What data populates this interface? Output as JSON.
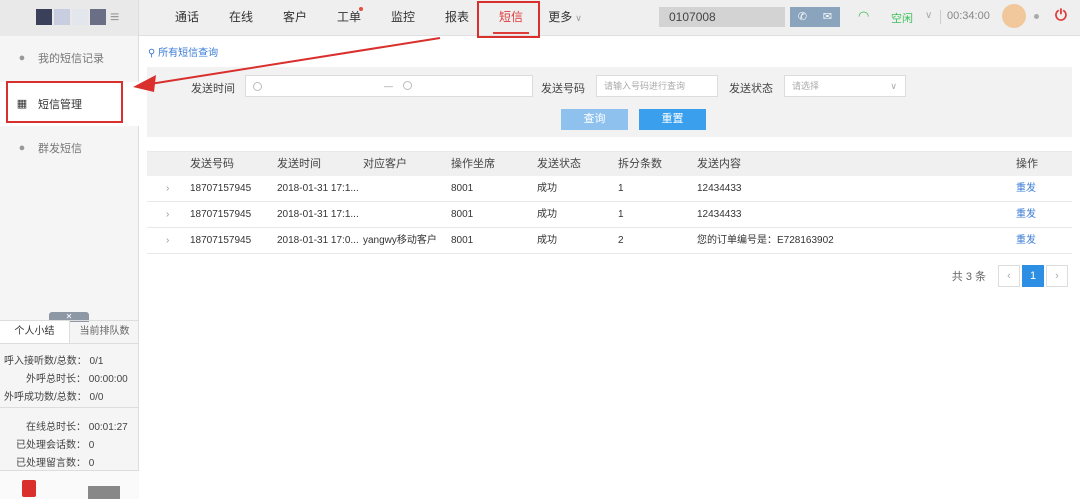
{
  "nav": {
    "items": [
      {
        "label": "通话",
        "dot": false
      },
      {
        "label": "在线",
        "dot": false
      },
      {
        "label": "客户",
        "dot": false
      },
      {
        "label": "工单",
        "dot": true
      },
      {
        "label": "监控",
        "dot": false
      },
      {
        "label": "报表",
        "dot": false
      },
      {
        "label": "短信",
        "dot": false,
        "active": true
      },
      {
        "label": "更多",
        "dot": false
      }
    ]
  },
  "header": {
    "phone_number": "0107008",
    "status": "空闲",
    "timer": "00:34:00"
  },
  "sidebar": {
    "items": [
      {
        "label": "我的短信记录",
        "icon": "chat-icon"
      },
      {
        "label": "短信管理",
        "icon": "grid-icon",
        "active": true
      },
      {
        "label": "群发短信",
        "icon": "group-chat-icon"
      }
    ],
    "stats_tabs": [
      "个人小结",
      "当前排队数"
    ],
    "stats": [
      "呼入接听数/总数： 0/1",
      "外呼总时长： 00:00:00",
      "外呼成功数/总数： 0/0",
      "在线总时长： 00:01:27",
      "已处理会话数： 0",
      "已处理留言数： 0"
    ]
  },
  "main": {
    "breadcrumb": "所有短信查询",
    "filters": {
      "send_time_label": "发送时间",
      "range_separator": "—",
      "send_number_label": "发送号码",
      "send_number_placeholder": "请输入号码进行查询",
      "send_status_label": "发送状态",
      "send_status_placeholder": "请选择"
    },
    "buttons": {
      "query": "查询",
      "reset": "重置"
    },
    "table": {
      "headers": [
        "发送号码",
        "发送时间",
        "对应客户",
        "操作坐席",
        "发送状态",
        "拆分条数",
        "发送内容",
        "操作"
      ],
      "rows": [
        {
          "number": "18707157945",
          "time": "2018-01-31 17:1...",
          "customer": "",
          "agent": "8001",
          "status": "成功",
          "splits": "1",
          "content": "12434433",
          "action": "重发"
        },
        {
          "number": "18707157945",
          "time": "2018-01-31 17:1...",
          "customer": "",
          "agent": "8001",
          "status": "成功",
          "splits": "1",
          "content": "12434433",
          "action": "重发"
        },
        {
          "number": "18707157945",
          "time": "2018-01-31 17:0...",
          "customer": "yangwy移动客户",
          "agent": "8001",
          "status": "成功",
          "splits": "2",
          "content": "您的订单编号是：E728163902",
          "action": "重发"
        }
      ]
    },
    "pagination": {
      "total": "共 3 条",
      "prev": "‹",
      "current": "1",
      "next": "›"
    }
  },
  "colors": {
    "accent": "#e03b3b",
    "link": "#3a7bd5",
    "primary_button": "#3aa0ee",
    "status_green": "#3fbf5c"
  }
}
